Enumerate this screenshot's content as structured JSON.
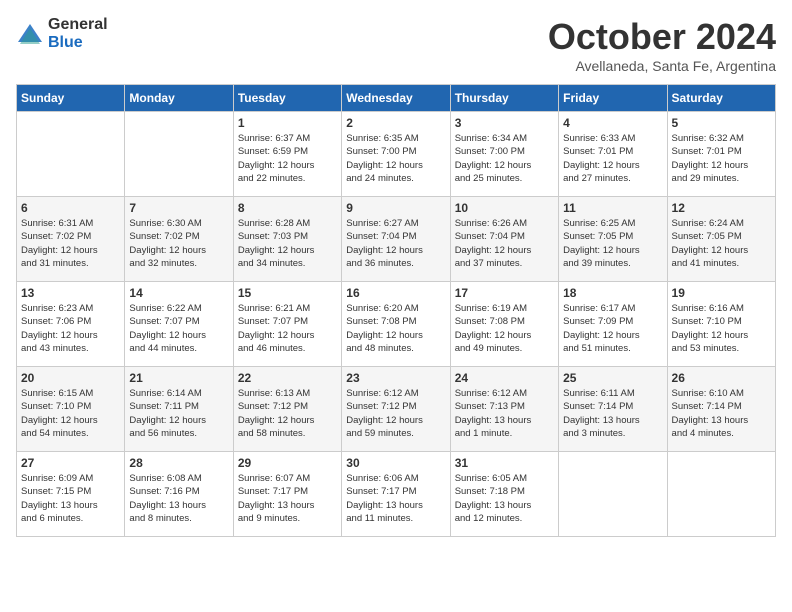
{
  "header": {
    "logo": {
      "general": "General",
      "blue": "Blue"
    },
    "title": "October 2024",
    "location": "Avellaneda, Santa Fe, Argentina"
  },
  "calendar": {
    "days_of_week": [
      "Sunday",
      "Monday",
      "Tuesday",
      "Wednesday",
      "Thursday",
      "Friday",
      "Saturday"
    ],
    "weeks": [
      [
        {
          "day": "",
          "info": ""
        },
        {
          "day": "",
          "info": ""
        },
        {
          "day": "1",
          "info": "Sunrise: 6:37 AM\nSunset: 6:59 PM\nDaylight: 12 hours\nand 22 minutes."
        },
        {
          "day": "2",
          "info": "Sunrise: 6:35 AM\nSunset: 7:00 PM\nDaylight: 12 hours\nand 24 minutes."
        },
        {
          "day": "3",
          "info": "Sunrise: 6:34 AM\nSunset: 7:00 PM\nDaylight: 12 hours\nand 25 minutes."
        },
        {
          "day": "4",
          "info": "Sunrise: 6:33 AM\nSunset: 7:01 PM\nDaylight: 12 hours\nand 27 minutes."
        },
        {
          "day": "5",
          "info": "Sunrise: 6:32 AM\nSunset: 7:01 PM\nDaylight: 12 hours\nand 29 minutes."
        }
      ],
      [
        {
          "day": "6",
          "info": "Sunrise: 6:31 AM\nSunset: 7:02 PM\nDaylight: 12 hours\nand 31 minutes."
        },
        {
          "day": "7",
          "info": "Sunrise: 6:30 AM\nSunset: 7:02 PM\nDaylight: 12 hours\nand 32 minutes."
        },
        {
          "day": "8",
          "info": "Sunrise: 6:28 AM\nSunset: 7:03 PM\nDaylight: 12 hours\nand 34 minutes."
        },
        {
          "day": "9",
          "info": "Sunrise: 6:27 AM\nSunset: 7:04 PM\nDaylight: 12 hours\nand 36 minutes."
        },
        {
          "day": "10",
          "info": "Sunrise: 6:26 AM\nSunset: 7:04 PM\nDaylight: 12 hours\nand 37 minutes."
        },
        {
          "day": "11",
          "info": "Sunrise: 6:25 AM\nSunset: 7:05 PM\nDaylight: 12 hours\nand 39 minutes."
        },
        {
          "day": "12",
          "info": "Sunrise: 6:24 AM\nSunset: 7:05 PM\nDaylight: 12 hours\nand 41 minutes."
        }
      ],
      [
        {
          "day": "13",
          "info": "Sunrise: 6:23 AM\nSunset: 7:06 PM\nDaylight: 12 hours\nand 43 minutes."
        },
        {
          "day": "14",
          "info": "Sunrise: 6:22 AM\nSunset: 7:07 PM\nDaylight: 12 hours\nand 44 minutes."
        },
        {
          "day": "15",
          "info": "Sunrise: 6:21 AM\nSunset: 7:07 PM\nDaylight: 12 hours\nand 46 minutes."
        },
        {
          "day": "16",
          "info": "Sunrise: 6:20 AM\nSunset: 7:08 PM\nDaylight: 12 hours\nand 48 minutes."
        },
        {
          "day": "17",
          "info": "Sunrise: 6:19 AM\nSunset: 7:08 PM\nDaylight: 12 hours\nand 49 minutes."
        },
        {
          "day": "18",
          "info": "Sunrise: 6:17 AM\nSunset: 7:09 PM\nDaylight: 12 hours\nand 51 minutes."
        },
        {
          "day": "19",
          "info": "Sunrise: 6:16 AM\nSunset: 7:10 PM\nDaylight: 12 hours\nand 53 minutes."
        }
      ],
      [
        {
          "day": "20",
          "info": "Sunrise: 6:15 AM\nSunset: 7:10 PM\nDaylight: 12 hours\nand 54 minutes."
        },
        {
          "day": "21",
          "info": "Sunrise: 6:14 AM\nSunset: 7:11 PM\nDaylight: 12 hours\nand 56 minutes."
        },
        {
          "day": "22",
          "info": "Sunrise: 6:13 AM\nSunset: 7:12 PM\nDaylight: 12 hours\nand 58 minutes."
        },
        {
          "day": "23",
          "info": "Sunrise: 6:12 AM\nSunset: 7:12 PM\nDaylight: 12 hours\nand 59 minutes."
        },
        {
          "day": "24",
          "info": "Sunrise: 6:12 AM\nSunset: 7:13 PM\nDaylight: 13 hours\nand 1 minute."
        },
        {
          "day": "25",
          "info": "Sunrise: 6:11 AM\nSunset: 7:14 PM\nDaylight: 13 hours\nand 3 minutes."
        },
        {
          "day": "26",
          "info": "Sunrise: 6:10 AM\nSunset: 7:14 PM\nDaylight: 13 hours\nand 4 minutes."
        }
      ],
      [
        {
          "day": "27",
          "info": "Sunrise: 6:09 AM\nSunset: 7:15 PM\nDaylight: 13 hours\nand 6 minutes."
        },
        {
          "day": "28",
          "info": "Sunrise: 6:08 AM\nSunset: 7:16 PM\nDaylight: 13 hours\nand 8 minutes."
        },
        {
          "day": "29",
          "info": "Sunrise: 6:07 AM\nSunset: 7:17 PM\nDaylight: 13 hours\nand 9 minutes."
        },
        {
          "day": "30",
          "info": "Sunrise: 6:06 AM\nSunset: 7:17 PM\nDaylight: 13 hours\nand 11 minutes."
        },
        {
          "day": "31",
          "info": "Sunrise: 6:05 AM\nSunset: 7:18 PM\nDaylight: 13 hours\nand 12 minutes."
        },
        {
          "day": "",
          "info": ""
        },
        {
          "day": "",
          "info": ""
        }
      ]
    ]
  }
}
